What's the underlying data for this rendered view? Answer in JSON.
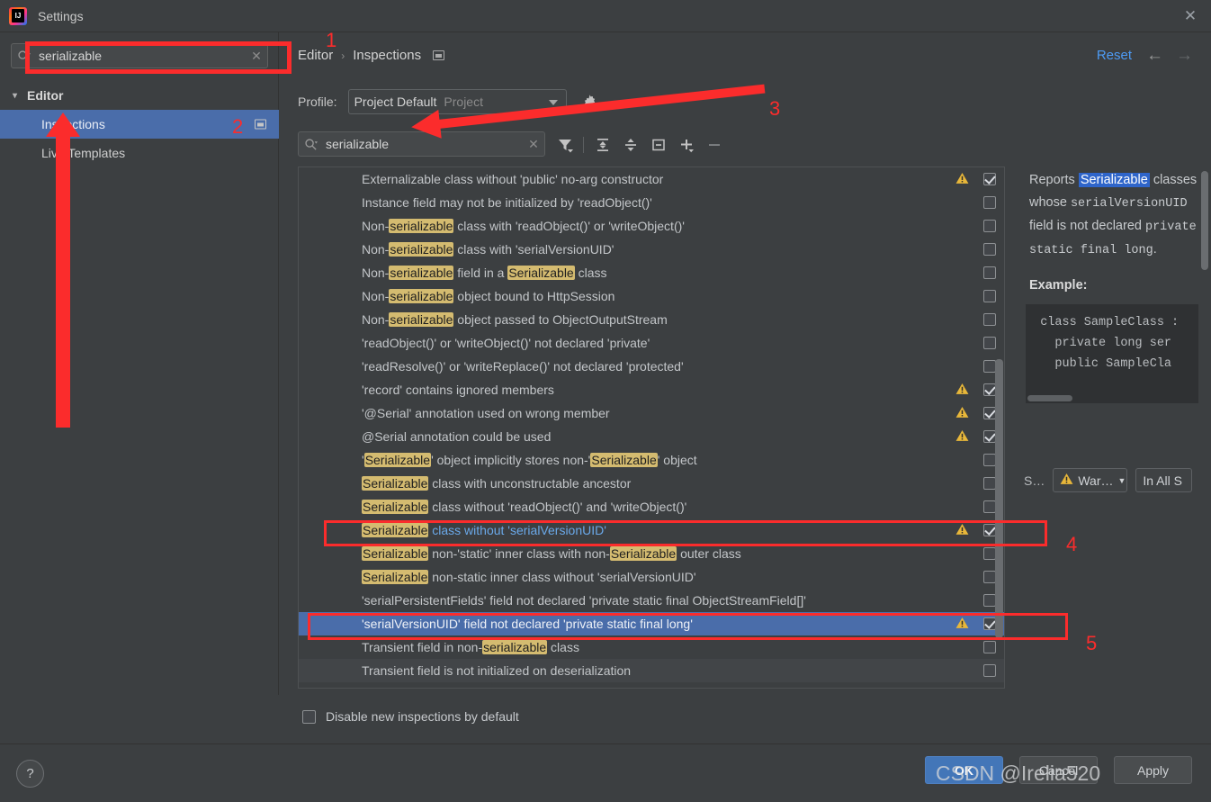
{
  "window": {
    "title": "Settings",
    "app_icon": "intellij-idea-icon",
    "close_icon": "close-icon"
  },
  "left_pane": {
    "search": {
      "value": "serializable",
      "placeholder": "",
      "icon": "search-icon",
      "clear_icon": "close-icon"
    },
    "tree": [
      {
        "label": "Editor",
        "level": 0,
        "expanded": true,
        "selected": false,
        "badge": false
      },
      {
        "label": "Inspections",
        "level": 1,
        "expanded": false,
        "selected": true,
        "badge": true
      },
      {
        "label": "Live Templates",
        "level": 1,
        "expanded": false,
        "selected": false,
        "badge": false
      }
    ]
  },
  "header": {
    "breadcrumb": [
      "Editor",
      "Inspections"
    ],
    "breadcrumb_separator": "›",
    "badge_icon": "settings-marker-icon",
    "reset_label": "Reset",
    "back_icon": "arrow-left-icon",
    "forward_icon": "arrow-right-icon"
  },
  "profile": {
    "label": "Profile:",
    "value": "Project Default",
    "scope": "Project",
    "caret_icon": "chevron-down-icon",
    "gear_icon": "gear-icon"
  },
  "inspection_toolbar": {
    "search": {
      "value": "serializable",
      "icon": "search-icon",
      "clear_icon": "close-icon"
    },
    "buttons": [
      {
        "name": "filter-icon",
        "glyph": "filter"
      },
      {
        "name": "expand-all-icon",
        "glyph": "expand"
      },
      {
        "name": "collapse-all-icon",
        "glyph": "collapse"
      },
      {
        "name": "toggle-icon",
        "glyph": "toggle"
      },
      {
        "name": "add-icon",
        "glyph": "plus"
      },
      {
        "name": "remove-icon",
        "glyph": "minus"
      }
    ]
  },
  "inspections": [
    {
      "parts": [
        {
          "t": "Externalizable class without 'public' no-arg constructor"
        }
      ],
      "warn": true,
      "checked": true,
      "selected": false
    },
    {
      "parts": [
        {
          "t": "Instance field may not be initialized by 'readObject()'"
        }
      ],
      "warn": false,
      "checked": false,
      "selected": false
    },
    {
      "parts": [
        {
          "t": "Non-"
        },
        {
          "t": "serializable",
          "hl": true
        },
        {
          "t": " class with 'readObject()' or 'writeObject()'"
        }
      ],
      "warn": false,
      "checked": false,
      "selected": false
    },
    {
      "parts": [
        {
          "t": "Non-"
        },
        {
          "t": "serializable",
          "hl": true
        },
        {
          "t": " class with 'serialVersionUID'"
        }
      ],
      "warn": false,
      "checked": false,
      "selected": false
    },
    {
      "parts": [
        {
          "t": "Non-"
        },
        {
          "t": "serializable",
          "hl": true
        },
        {
          "t": " field in a "
        },
        {
          "t": "Serializable",
          "hl": true
        },
        {
          "t": " class"
        }
      ],
      "warn": false,
      "checked": false,
      "selected": false
    },
    {
      "parts": [
        {
          "t": "Non-"
        },
        {
          "t": "serializable",
          "hl": true
        },
        {
          "t": " object bound to HttpSession"
        }
      ],
      "warn": false,
      "checked": false,
      "selected": false
    },
    {
      "parts": [
        {
          "t": "Non-"
        },
        {
          "t": "serializable",
          "hl": true
        },
        {
          "t": " object passed to ObjectOutputStream"
        }
      ],
      "warn": false,
      "checked": false,
      "selected": false
    },
    {
      "parts": [
        {
          "t": "'readObject()' or 'writeObject()' not declared 'private'"
        }
      ],
      "warn": false,
      "checked": false,
      "selected": false
    },
    {
      "parts": [
        {
          "t": "'readResolve()' or 'writeReplace()' not declared 'protected'"
        }
      ],
      "warn": false,
      "checked": false,
      "selected": false
    },
    {
      "parts": [
        {
          "t": "'record' contains ignored members"
        }
      ],
      "warn": true,
      "checked": true,
      "selected": false
    },
    {
      "parts": [
        {
          "t": "'@Serial' annotation used on wrong member"
        }
      ],
      "warn": true,
      "checked": true,
      "selected": false
    },
    {
      "parts": [
        {
          "t": "@Serial annotation could be used"
        }
      ],
      "warn": true,
      "checked": true,
      "selected": false
    },
    {
      "parts": [
        {
          "t": "'"
        },
        {
          "t": "Serializable",
          "hl": true
        },
        {
          "t": "' object implicitly stores non-'"
        },
        {
          "t": "Serializable",
          "hl": true
        },
        {
          "t": "' object"
        }
      ],
      "warn": false,
      "checked": false,
      "selected": false
    },
    {
      "parts": [
        {
          "t": "Serializable",
          "hl": true
        },
        {
          "t": " class with unconstructable ancestor"
        }
      ],
      "warn": false,
      "checked": false,
      "selected": false
    },
    {
      "parts": [
        {
          "t": "Serializable",
          "hl": true
        },
        {
          "t": " class without 'readObject()' and 'writeObject()'"
        }
      ],
      "warn": false,
      "checked": false,
      "selected": false
    },
    {
      "parts": [
        {
          "t": "Serializable",
          "hl": true
        },
        {
          "t": " class without 'serialVersionUID'",
          "blue": true
        }
      ],
      "warn": true,
      "checked": true,
      "selected": false
    },
    {
      "parts": [
        {
          "t": "Serializable",
          "hl": true
        },
        {
          "t": " non-'static' inner class with non-"
        },
        {
          "t": "Serializable",
          "hl": true
        },
        {
          "t": " outer class"
        }
      ],
      "warn": false,
      "checked": false,
      "selected": false
    },
    {
      "parts": [
        {
          "t": "Serializable",
          "hl": true
        },
        {
          "t": " non-static inner class without 'serialVersionUID'"
        }
      ],
      "warn": false,
      "checked": false,
      "selected": false
    },
    {
      "parts": [
        {
          "t": "'serialPersistentFields' field not declared 'private static final ObjectStreamField[]'"
        }
      ],
      "warn": false,
      "checked": false,
      "selected": false
    },
    {
      "parts": [
        {
          "t": "'serialVersionUID' field not declared 'private static final long'"
        }
      ],
      "warn": true,
      "checked": true,
      "selected": true
    },
    {
      "parts": [
        {
          "t": "Transient field in non-"
        },
        {
          "t": "serializable",
          "hl": true
        },
        {
          "t": " class"
        }
      ],
      "warn": false,
      "checked": false,
      "selected": false
    },
    {
      "parts": [
        {
          "t": "Transient field is not initialized on deserialization"
        }
      ],
      "warn": false,
      "checked": false,
      "selected": false
    }
  ],
  "description": {
    "line1_pre": "Reports ",
    "line1_hl": "Serializable",
    "line2": "classes whose",
    "line3_mono": "serialVersionUID",
    "line3_rest": " field is",
    "line4_pre": "not declared ",
    "line4_mono": "private",
    "line5_mono": "static final long",
    "line5_rest": ".",
    "example_label": "Example:",
    "code": [
      "  class SampleClass :",
      "    private long ser",
      "",
      "    public SampleCla"
    ]
  },
  "severity": {
    "label": "S…",
    "level": "War…",
    "level_icon": "warning-triangle-icon",
    "level_caret_icon": "chevron-down-icon",
    "scope": "In All S"
  },
  "bottom": {
    "disable_new_label": "Disable new inspections by default",
    "disable_new_checked": false,
    "help_icon": "help-icon",
    "ok_label": "OK",
    "cancel_label": "Cancel",
    "apply_label": "Apply"
  },
  "annotations": {
    "n1": "1",
    "n2": "2",
    "n3": "3",
    "n4": "4",
    "n5": "5",
    "color": "#fb2c2c"
  },
  "watermark": "CSDN @Irelia520"
}
